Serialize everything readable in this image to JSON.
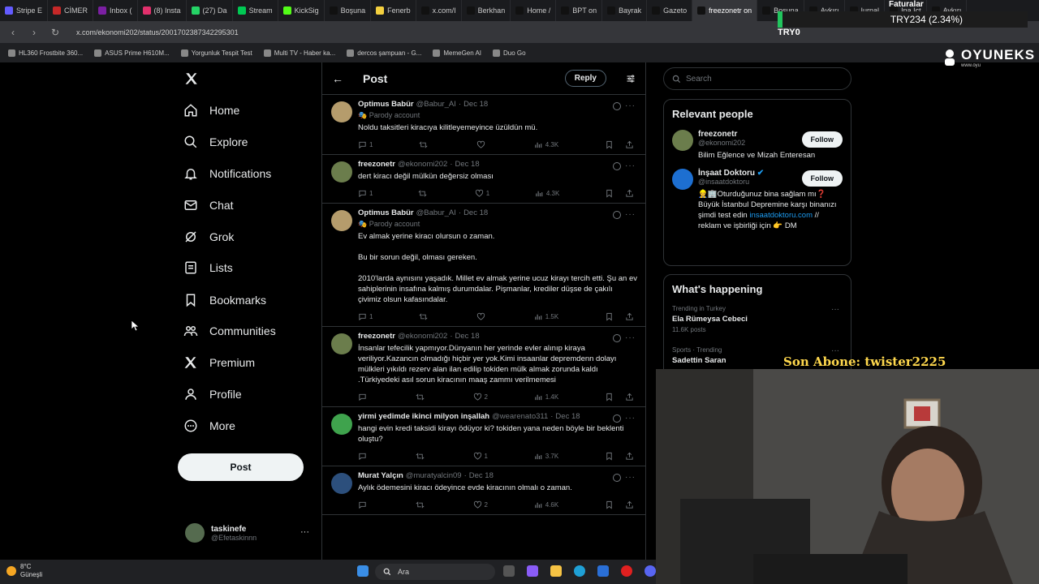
{
  "browser": {
    "tabs": [
      {
        "label": "Stripe E",
        "color": "#635bff"
      },
      {
        "label": "CİMER",
        "color": "#c62828"
      },
      {
        "label": "Inbox (",
        "color": "#7b1fa2"
      },
      {
        "label": "(8) Insta",
        "color": "#e1306c"
      },
      {
        "label": "(27) Da",
        "color": "#25d366"
      },
      {
        "label": "Stream",
        "color": "#00c853"
      },
      {
        "label": "KickSig",
        "color": "#53fc18"
      },
      {
        "label": "Boşuna",
        "color": "#111111"
      },
      {
        "label": "Fenerb",
        "color": "#f4d03f"
      },
      {
        "label": "x.com/I",
        "color": "#111111"
      },
      {
        "label": "Berkhan",
        "color": "#111111"
      },
      {
        "label": "Home /",
        "color": "#111111"
      },
      {
        "label": "BPT on",
        "color": "#111111"
      },
      {
        "label": "Bayrak",
        "color": "#111111"
      },
      {
        "label": "Gazeto",
        "color": "#111111"
      },
      {
        "label": "freezonetr on",
        "color": "#111111"
      },
      {
        "label": "Boşuna",
        "color": "#111111"
      },
      {
        "label": "Aykırı",
        "color": "#111111"
      },
      {
        "label": "Iurnal",
        "color": "#111111"
      },
      {
        "label": "Ina Ict",
        "color": "#111111"
      },
      {
        "label": "Aykırı",
        "color": "#111111"
      }
    ],
    "url": "x.com/ekonomi202/status/2001702387342295301",
    "bookmarks": [
      "HL360 Frostbite 360...",
      "ASUS Prime H610M...",
      "Yorgunluk Tespit Test",
      "Multi TV - Haber ka...",
      "dercos şampuan - G...",
      "MemeGen AI",
      "Duo Go"
    ]
  },
  "overlay": {
    "ticker": "TRY234 (2.34%)",
    "ticker_sub": "TRY0",
    "faturalar": "Faturalar",
    "logo": "OYUNEKS",
    "logo_sub": "www.oyu",
    "subscriber": "Son Abone: twister2225"
  },
  "nav": {
    "items": [
      {
        "label": "Home",
        "icon": "home-icon"
      },
      {
        "label": "Explore",
        "icon": "search-icon"
      },
      {
        "label": "Notifications",
        "icon": "bell-icon"
      },
      {
        "label": "Chat",
        "icon": "mail-icon"
      },
      {
        "label": "Grok",
        "icon": "grok-icon"
      },
      {
        "label": "Lists",
        "icon": "list-icon"
      },
      {
        "label": "Bookmarks",
        "icon": "bookmark-icon"
      },
      {
        "label": "Communities",
        "icon": "people-icon"
      },
      {
        "label": "Premium",
        "icon": "x-logo-icon"
      },
      {
        "label": "Profile",
        "icon": "person-icon"
      },
      {
        "label": "More",
        "icon": "more-circle-icon"
      }
    ],
    "post_label": "Post",
    "account": {
      "name": "taskinefe",
      "handle": "@Efetaskinnn"
    }
  },
  "main": {
    "title": "Post",
    "reply_label": "Reply",
    "tweets": [
      {
        "name": "Optimus Babür",
        "handle": "@Babur_AI",
        "date": "Dec 18",
        "parody": "Parody account",
        "text": "Noldu taksitleri kiracıya kilitleyemeyince üzüldün mü.",
        "replies": "1",
        "retweets": "",
        "likes": "",
        "views": "4.3K",
        "avatar": "#b59c6c"
      },
      {
        "name": "freezonetr",
        "handle": "@ekonomi202",
        "date": "Dec 18",
        "parody": "",
        "text": "dert kiracı değil mülkün değersiz olması",
        "replies": "1",
        "retweets": "",
        "likes": "1",
        "views": "4.3K",
        "avatar": "#6b7d4c"
      },
      {
        "name": "Optimus Babür",
        "handle": "@Babur_AI",
        "date": "Dec 18",
        "parody": "Parody account",
        "text": "Ev almak yerine kiracı olursun o zaman.\n\nBu bir sorun değil, olması gereken.\n\n2010'larda aynısını yaşadık. Millet ev almak yerine ucuz kirayı tercih etti. Şu an ev sahiplerinin insafına kalmış durumdalar. Pişmanlar, krediler düşse de çakılı çivimiz olsun kafasındalar.",
        "replies": "1",
        "retweets": "",
        "likes": "",
        "views": "1.5K",
        "avatar": "#b59c6c"
      },
      {
        "name": "freezonetr",
        "handle": "@ekonomi202",
        "date": "Dec 18",
        "parody": "",
        "text": "İnsanlar tefecilik yapmıyor.Dünyanın her yerinde evler alınıp kiraya veriliyor.Kazancın olmadığı hiçbir yer yok.Kimi insaanlar depremdenn dolayı mülkleri yıkıldı rezerv alan ilan edilip tokiden mülk almak zorunda kaldı .Türkiyedeki asıl sorun kiracının maaş zammı verilmemesi",
        "replies": "",
        "retweets": "",
        "likes": "2",
        "views": "1.4K",
        "avatar": "#6b7d4c"
      },
      {
        "name": "yirmi yedimde ikinci milyon inşallah",
        "handle": "@wearenato311",
        "date": "Dec 18",
        "parody": "",
        "text": "hangi evin kredi taksidi kirayı ödüyor ki? tokiden yana neden böyle bir beklenti oluştu?",
        "replies": "",
        "retweets": "",
        "likes": "1",
        "views": "3.7K",
        "avatar": "#3fa34d"
      },
      {
        "name": "Murat Yalçın",
        "handle": "@muratyalcin09",
        "date": "Dec 18",
        "parody": "",
        "text": "Aylık ödemesini kiracı ödeyince evde kiracının olmalı o zaman.",
        "replies": "",
        "retweets": "",
        "likes": "2",
        "views": "4.6K",
        "avatar": "#2c4f7c"
      }
    ]
  },
  "right": {
    "search_placeholder": "Search",
    "relevant_title": "Relevant people",
    "people": [
      {
        "name": "freezonetr",
        "handle": "@ekonomi202",
        "bio": "Bilim Eğlence ve Mizah Enteresan",
        "link": "",
        "bio_end": "",
        "follow": "Follow",
        "avatar": "#6b7d4c"
      },
      {
        "name": "İnşaat Doktoru",
        "handle": "@insaatdoktoru",
        "bio": "👷🏢Oturduğunuz bina sağlam mı❓ Büyük İstanbul Depremine karşı binanızı şimdi test edin",
        "link": "insaatdoktoru.com",
        "bio_end": "// reklam ve işbirliği için 👉 DM",
        "follow": "Follow",
        "avatar": "#1d6fd1"
      }
    ],
    "happening_title": "What's happening",
    "trends": [
      {
        "category": "Trending in Turkey",
        "name": "Ela Rümeysa Cebeci",
        "posts": "11.6K posts"
      },
      {
        "category": "Sports · Trending",
        "name": "Sadettin Saran",
        "posts": ""
      }
    ]
  },
  "taskbar": {
    "temp": "8°C",
    "place": "Güneşli",
    "search": "Ara"
  },
  "colors": {
    "accent": "#1d9bf0",
    "bg": "#000000",
    "border": "#2f3336",
    "muted": "#71767b"
  }
}
